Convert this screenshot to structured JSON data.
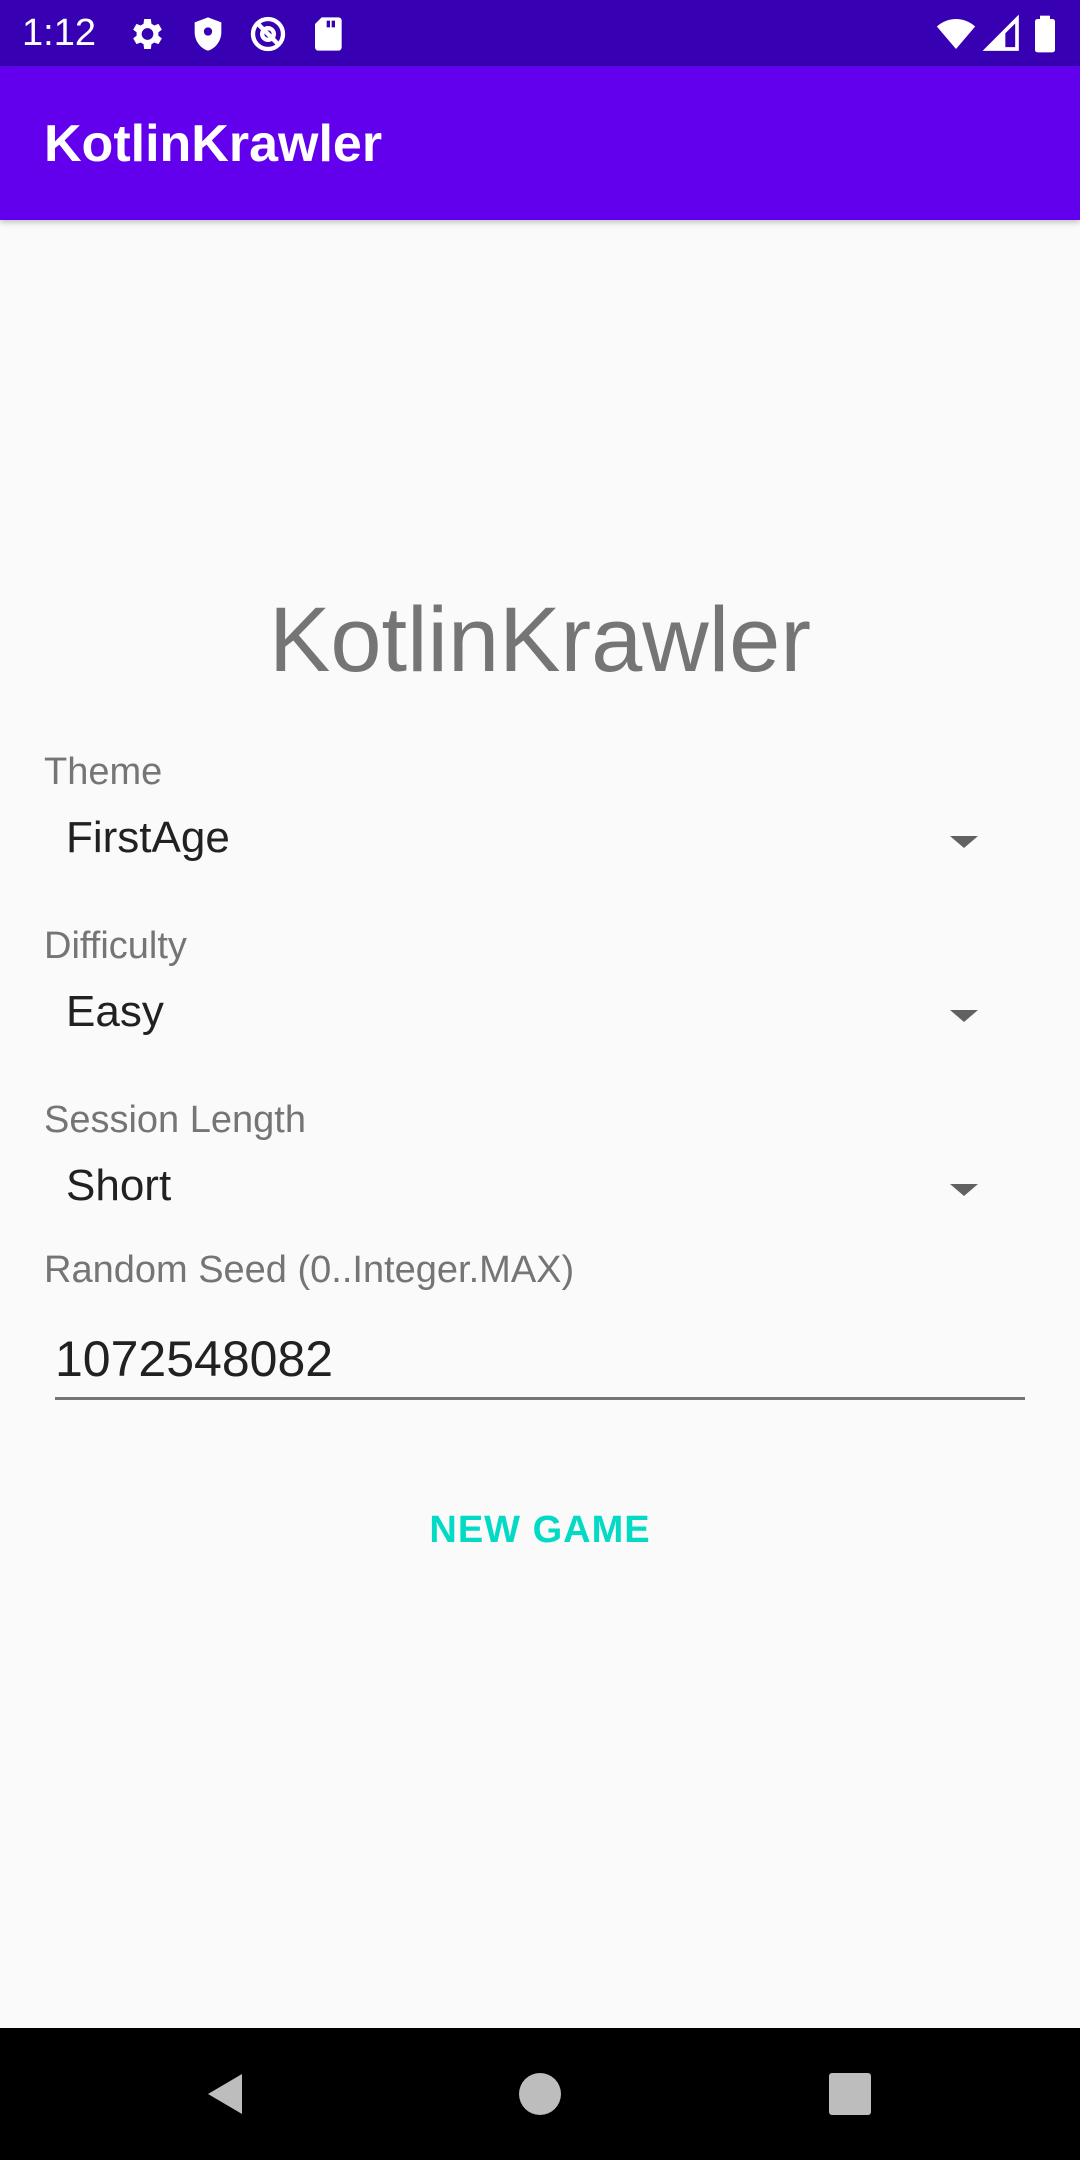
{
  "status_bar": {
    "time": "1:12",
    "left_icons": [
      "gear-icon",
      "shield-icon",
      "at-sign-icon",
      "sd-card-icon"
    ],
    "right_icons": [
      "wifi-icon",
      "signal-icon",
      "battery-icon"
    ],
    "background": "#3700b3"
  },
  "app_bar": {
    "title": "KotlinKrawler",
    "background": "#6200ee"
  },
  "main": {
    "title": "KotlinKrawler",
    "theme": {
      "label": "Theme",
      "value": "FirstAge"
    },
    "difficulty": {
      "label": "Difficulty",
      "value": "Easy"
    },
    "session_length": {
      "label": "Session Length",
      "value": "Short"
    },
    "random_seed": {
      "label": "Random Seed (0..Integer.MAX)",
      "value": "1072548082"
    },
    "new_game_label": "NEW GAME",
    "accent_color": "#03dac5"
  },
  "nav_bar": {
    "buttons": [
      "back-icon",
      "home-icon",
      "recents-icon"
    ]
  }
}
